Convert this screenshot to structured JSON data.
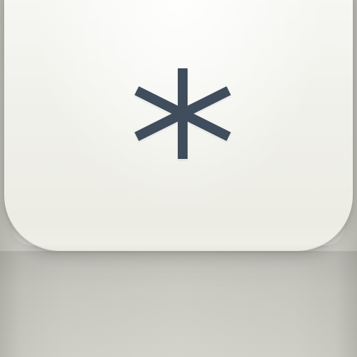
{
  "icon": {
    "glyph_name": "asterisk-icon",
    "glyph_color": "#3f4d5c",
    "keycap_color": "#f1f1ec",
    "base_color": "#c9c9c1"
  }
}
